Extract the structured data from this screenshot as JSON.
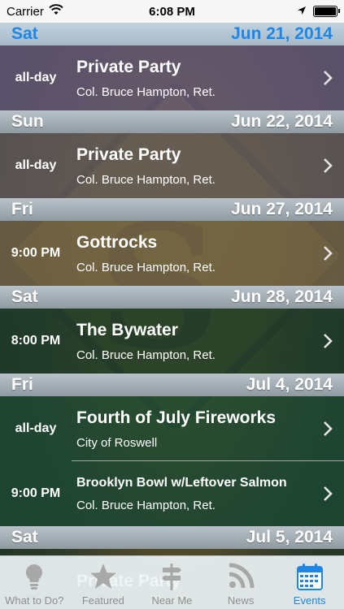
{
  "status_bar": {
    "carrier": "Carrier",
    "time": "6:08 PM",
    "battery_level": 1.0
  },
  "sections": [
    {
      "day": "Sat",
      "date": "Jun 21, 2014",
      "active": true,
      "events": [
        {
          "time": "all-day",
          "title": "Private Party",
          "venue": "Col. Bruce Hampton, Ret.",
          "bg": "#5e5470"
        }
      ]
    },
    {
      "day": "Sun",
      "date": "Jun 22, 2014",
      "events": [
        {
          "time": "all-day",
          "title": "Private Party",
          "venue": "Col. Bruce Hampton, Ret.",
          "bg": "#5c5556"
        }
      ]
    },
    {
      "day": "Fri",
      "date": "Jun 27, 2014",
      "events": [
        {
          "time": "9:00 PM",
          "title": "Gottrocks",
          "venue": "Col. Bruce Hampton, Ret.",
          "bg": "#6a5d45"
        }
      ]
    },
    {
      "day": "Sat",
      "date": "Jun 28, 2014",
      "events": [
        {
          "time": "8:00 PM",
          "title": "The Bywater",
          "venue": "Col. Bruce Hampton, Ret.",
          "bg": "#1d3a2a"
        }
      ]
    },
    {
      "day": "Fri",
      "date": "Jul 4, 2014",
      "events": [
        {
          "time": "all-day",
          "title": "Fourth of July Fireworks",
          "venue": "City of Roswell",
          "bg": "#1c4632"
        },
        {
          "time": "9:00 PM",
          "title": "Brooklyn Bowl w/Leftover Salmon",
          "venue": "Col. Bruce Hampton, Ret.",
          "bg": "#1c4632"
        }
      ]
    },
    {
      "day": "Sat",
      "date": "Jul 5, 2014",
      "events": [
        {
          "title": "Private Party"
        }
      ]
    }
  ],
  "tabs": [
    {
      "label": "What to Do?",
      "icon": "lightbulb-icon",
      "active": false
    },
    {
      "label": "Featured",
      "icon": "star-icon",
      "active": false
    },
    {
      "label": "Near Me",
      "icon": "signpost-icon",
      "active": false
    },
    {
      "label": "News",
      "icon": "rss-icon",
      "active": false
    },
    {
      "label": "Events",
      "icon": "calendar-icon",
      "active": true
    }
  ],
  "colors": {
    "accent": "#1e86e6",
    "header_gray": "#a3adb3",
    "tab_inactive": "#8e8e8e"
  }
}
